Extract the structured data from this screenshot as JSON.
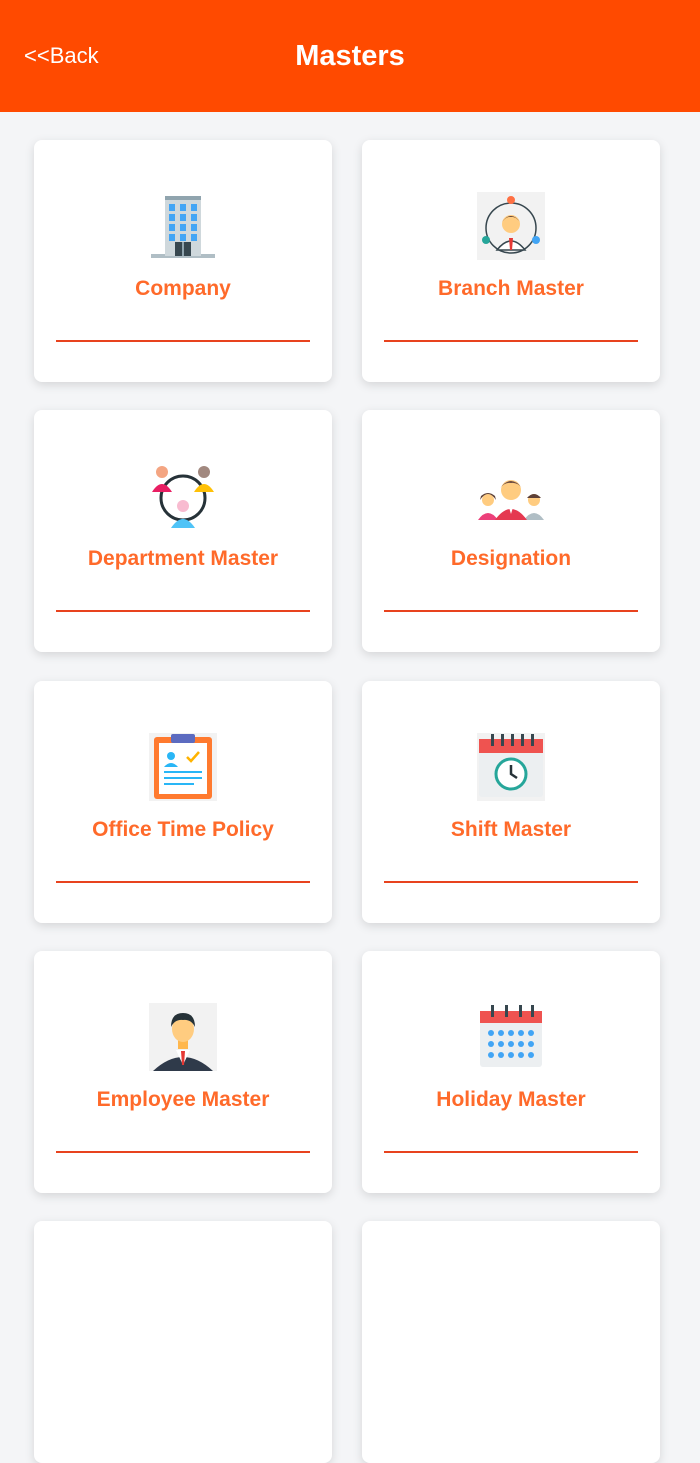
{
  "header": {
    "back_label": "<<Back",
    "title": "Masters",
    "color": "#ff4a00"
  },
  "accent": "#ff6a2a",
  "tiles": [
    {
      "label": "Company",
      "icon": "office-building-icon"
    },
    {
      "label": "Branch Master",
      "icon": "network-person-icon"
    },
    {
      "label": "Department Master",
      "icon": "team-circle-icon"
    },
    {
      "label": "Designation",
      "icon": "people-group-icon"
    },
    {
      "label": "Office Time Policy",
      "icon": "clipboard-icon"
    },
    {
      "label": "Shift Master",
      "icon": "calendar-clock-icon"
    },
    {
      "label": "Employee Master",
      "icon": "businessman-icon"
    },
    {
      "label": "Holiday Master",
      "icon": "calendar-icon"
    }
  ]
}
